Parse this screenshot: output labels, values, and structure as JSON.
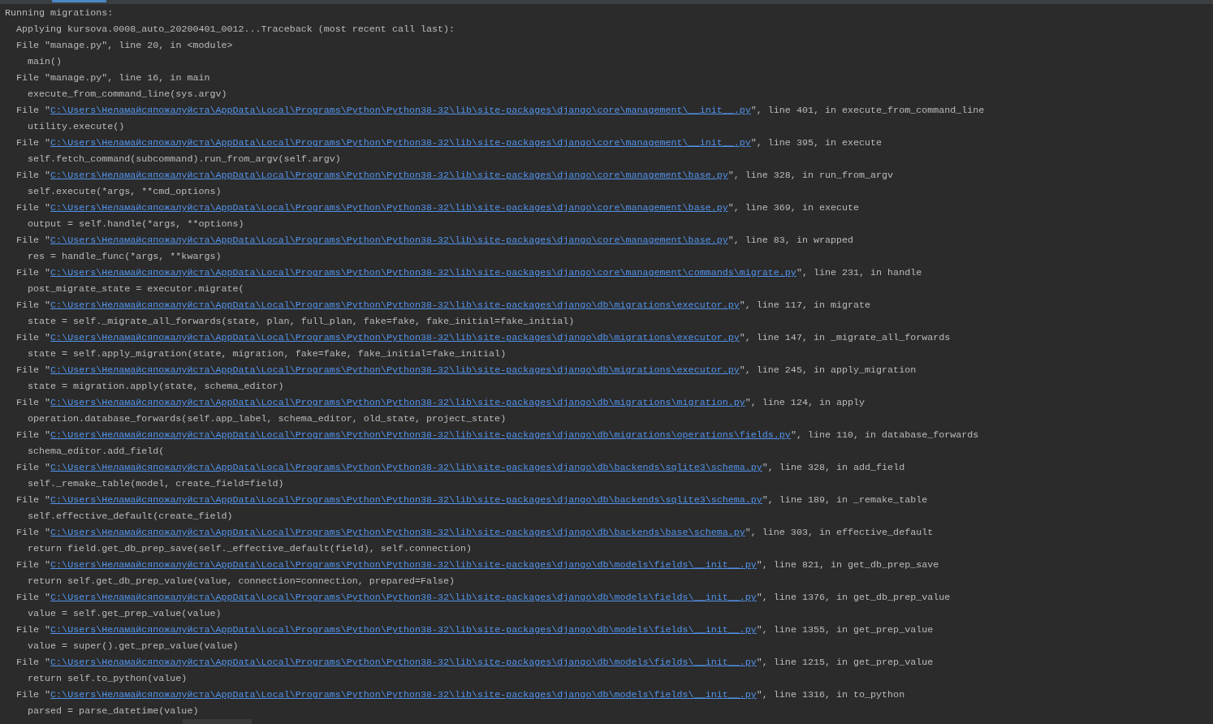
{
  "tabs_strip": {
    "active_tab": {
      "selected": true
    }
  },
  "console": {
    "lines": [
      {
        "kind": "header",
        "text": "Running migrations:"
      },
      {
        "kind": "message",
        "text": "Applying kursova.0008_auto_20200401_0012...Traceback (most recent call last):"
      },
      {
        "kind": "message",
        "text": "File \"manage.py\", line 20, in <module>"
      },
      {
        "kind": "code",
        "text": "main()"
      },
      {
        "kind": "message",
        "text": "File \"manage.py\", line 16, in main"
      },
      {
        "kind": "code",
        "text": "execute_from_command_line(sys.argv)"
      },
      {
        "kind": "frame",
        "prefix": "File \"",
        "path": "C:\\Users\\Неламайсяпожалуйста\\AppData\\Local\\Programs\\Python\\Python38-32\\lib\\site-packages\\django\\core\\management\\__init__.py",
        "suffix": "\", line 401, in execute_from_command_line"
      },
      {
        "kind": "code",
        "text": "utility.execute()"
      },
      {
        "kind": "frame",
        "prefix": "File \"",
        "path": "C:\\Users\\Неламайсяпожалуйста\\AppData\\Local\\Programs\\Python\\Python38-32\\lib\\site-packages\\django\\core\\management\\__init__.py",
        "suffix": "\", line 395, in execute"
      },
      {
        "kind": "code",
        "text": "self.fetch_command(subcommand).run_from_argv(self.argv)"
      },
      {
        "kind": "frame",
        "prefix": "File \"",
        "path": "C:\\Users\\Неламайсяпожалуйста\\AppData\\Local\\Programs\\Python\\Python38-32\\lib\\site-packages\\django\\core\\management\\base.py",
        "suffix": "\", line 328, in run_from_argv"
      },
      {
        "kind": "code",
        "text": "self.execute(*args, **cmd_options)"
      },
      {
        "kind": "frame",
        "prefix": "File \"",
        "path": "C:\\Users\\Неламайсяпожалуйста\\AppData\\Local\\Programs\\Python\\Python38-32\\lib\\site-packages\\django\\core\\management\\base.py",
        "suffix": "\", line 369, in execute"
      },
      {
        "kind": "code",
        "text": "output = self.handle(*args, **options)"
      },
      {
        "kind": "frame",
        "prefix": "File \"",
        "path": "C:\\Users\\Неламайсяпожалуйста\\AppData\\Local\\Programs\\Python\\Python38-32\\lib\\site-packages\\django\\core\\management\\base.py",
        "suffix": "\", line 83, in wrapped"
      },
      {
        "kind": "code",
        "text": "res = handle_func(*args, **kwargs)"
      },
      {
        "kind": "frame",
        "prefix": "File \"",
        "path": "C:\\Users\\Неламайсяпожалуйста\\AppData\\Local\\Programs\\Python\\Python38-32\\lib\\site-packages\\django\\core\\management\\commands\\migrate.py",
        "suffix": "\", line 231, in handle"
      },
      {
        "kind": "code",
        "text": "post_migrate_state = executor.migrate("
      },
      {
        "kind": "frame",
        "prefix": "File \"",
        "path": "C:\\Users\\Неламайсяпожалуйста\\AppData\\Local\\Programs\\Python\\Python38-32\\lib\\site-packages\\django\\db\\migrations\\executor.py",
        "suffix": "\", line 117, in migrate"
      },
      {
        "kind": "code",
        "text": "state = self._migrate_all_forwards(state, plan, full_plan, fake=fake, fake_initial=fake_initial)"
      },
      {
        "kind": "frame",
        "prefix": "File \"",
        "path": "C:\\Users\\Неламайсяпожалуйста\\AppData\\Local\\Programs\\Python\\Python38-32\\lib\\site-packages\\django\\db\\migrations\\executor.py",
        "suffix": "\", line 147, in _migrate_all_forwards"
      },
      {
        "kind": "code",
        "text": "state = self.apply_migration(state, migration, fake=fake, fake_initial=fake_initial)"
      },
      {
        "kind": "frame",
        "prefix": "File \"",
        "path": "C:\\Users\\Неламайсяпожалуйста\\AppData\\Local\\Programs\\Python\\Python38-32\\lib\\site-packages\\django\\db\\migrations\\executor.py",
        "suffix": "\", line 245, in apply_migration"
      },
      {
        "kind": "code",
        "text": "state = migration.apply(state, schema_editor)"
      },
      {
        "kind": "frame",
        "prefix": "File \"",
        "path": "C:\\Users\\Неламайсяпожалуйста\\AppData\\Local\\Programs\\Python\\Python38-32\\lib\\site-packages\\django\\db\\migrations\\migration.py",
        "suffix": "\", line 124, in apply"
      },
      {
        "kind": "code",
        "text": "operation.database_forwards(self.app_label, schema_editor, old_state, project_state)"
      },
      {
        "kind": "frame",
        "prefix": "File \"",
        "path": "C:\\Users\\Неламайсяпожалуйста\\AppData\\Local\\Programs\\Python\\Python38-32\\lib\\site-packages\\django\\db\\migrations\\operations\\fields.py",
        "suffix": "\", line 110, in database_forwards"
      },
      {
        "kind": "code",
        "text": "schema_editor.add_field("
      },
      {
        "kind": "frame",
        "prefix": "File \"",
        "path": "C:\\Users\\Неламайсяпожалуйста\\AppData\\Local\\Programs\\Python\\Python38-32\\lib\\site-packages\\django\\db\\backends\\sqlite3\\schema.py",
        "suffix": "\", line 328, in add_field"
      },
      {
        "kind": "code",
        "text": "self._remake_table(model, create_field=field)"
      },
      {
        "kind": "frame",
        "prefix": "File \"",
        "path": "C:\\Users\\Неламайсяпожалуйста\\AppData\\Local\\Programs\\Python\\Python38-32\\lib\\site-packages\\django\\db\\backends\\sqlite3\\schema.py",
        "suffix": "\", line 189, in _remake_table"
      },
      {
        "kind": "code",
        "text": "self.effective_default(create_field)"
      },
      {
        "kind": "frame",
        "prefix": "File \"",
        "path": "C:\\Users\\Неламайсяпожалуйста\\AppData\\Local\\Programs\\Python\\Python38-32\\lib\\site-packages\\django\\db\\backends\\base\\schema.py",
        "suffix": "\", line 303, in effective_default"
      },
      {
        "kind": "code",
        "text": "return field.get_db_prep_save(self._effective_default(field), self.connection)"
      },
      {
        "kind": "frame",
        "prefix": "File \"",
        "path": "C:\\Users\\Неламайсяпожалуйста\\AppData\\Local\\Programs\\Python\\Python38-32\\lib\\site-packages\\django\\db\\models\\fields\\__init__.py",
        "suffix": "\", line 821, in get_db_prep_save"
      },
      {
        "kind": "code",
        "text": "return self.get_db_prep_value(value, connection=connection, prepared=False)"
      },
      {
        "kind": "frame",
        "prefix": "File \"",
        "path": "C:\\Users\\Неламайсяпожалуйста\\AppData\\Local\\Programs\\Python\\Python38-32\\lib\\site-packages\\django\\db\\models\\fields\\__init__.py",
        "suffix": "\", line 1376, in get_db_prep_value"
      },
      {
        "kind": "code",
        "text": "value = self.get_prep_value(value)"
      },
      {
        "kind": "frame",
        "prefix": "File \"",
        "path": "C:\\Users\\Неламайсяпожалуйста\\AppData\\Local\\Programs\\Python\\Python38-32\\lib\\site-packages\\django\\db\\models\\fields\\__init__.py",
        "suffix": "\", line 1355, in get_prep_value"
      },
      {
        "kind": "code",
        "text": "value = super().get_prep_value(value)"
      },
      {
        "kind": "frame",
        "prefix": "File \"",
        "path": "C:\\Users\\Неламайсяпожалуйста\\AppData\\Local\\Programs\\Python\\Python38-32\\lib\\site-packages\\django\\db\\models\\fields\\__init__.py",
        "suffix": "\", line 1215, in get_prep_value"
      },
      {
        "kind": "code",
        "text": "return self.to_python(value)"
      },
      {
        "kind": "frame",
        "prefix": "File \"",
        "path": "C:\\Users\\Неламайсяпожалуйста\\AppData\\Local\\Programs\\Python\\Python38-32\\lib\\site-packages\\django\\db\\models\\fields\\__init__.py",
        "suffix": "\", line 1316, in to_python"
      },
      {
        "kind": "code",
        "text": "parsed = parse_datetime(value)"
      }
    ]
  }
}
